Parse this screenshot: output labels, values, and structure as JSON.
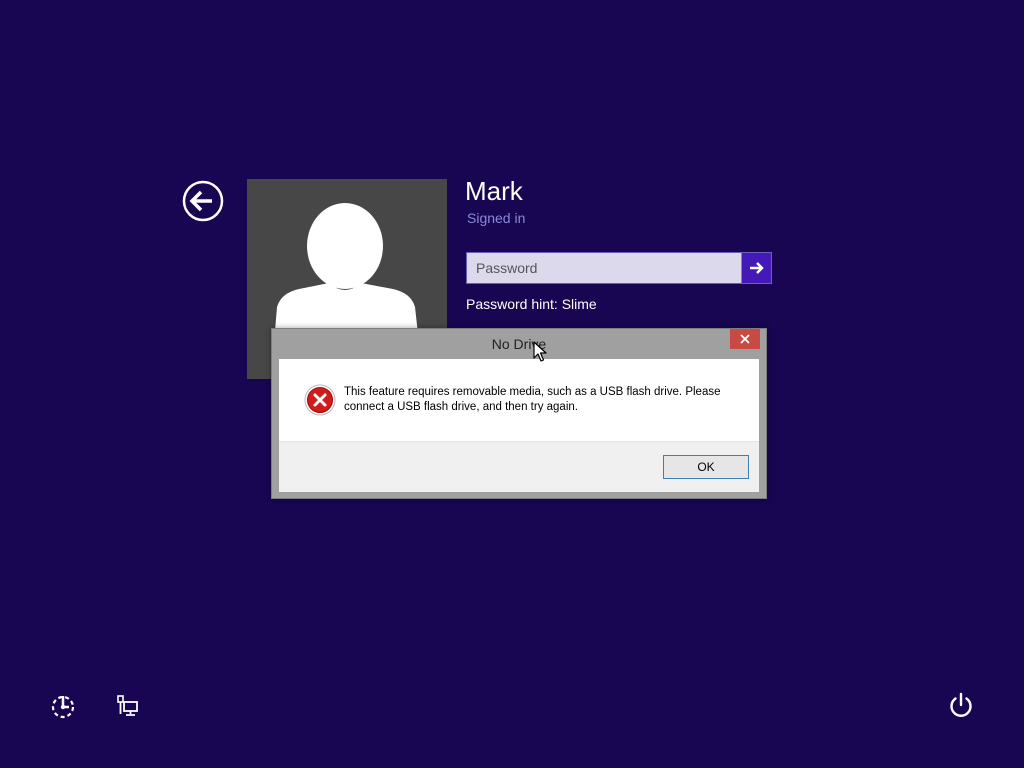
{
  "login": {
    "user_name": "Mark",
    "user_status": "Signed in",
    "password_placeholder": "Password",
    "password_value": "",
    "password_hint": "Password hint: Slime"
  },
  "dialog": {
    "title": "No Drive",
    "message": "This feature requires removable media, such as a USB flash drive. Please connect a USB flash drive, and then try again.",
    "ok_label": "OK"
  },
  "icons": {
    "back": "back-arrow-icon",
    "avatar": "user-avatar-icon",
    "submit": "arrow-right-icon",
    "error": "error-x-icon",
    "close": "close-icon",
    "ease_of_access": "ease-of-access-icon",
    "network": "network-icon",
    "power": "power-icon"
  },
  "colors": {
    "background": "#180652",
    "accent": "#4419b8",
    "status_text": "#8a8ad8",
    "close_button": "#c74a43",
    "error_red": "#d21b1b"
  }
}
